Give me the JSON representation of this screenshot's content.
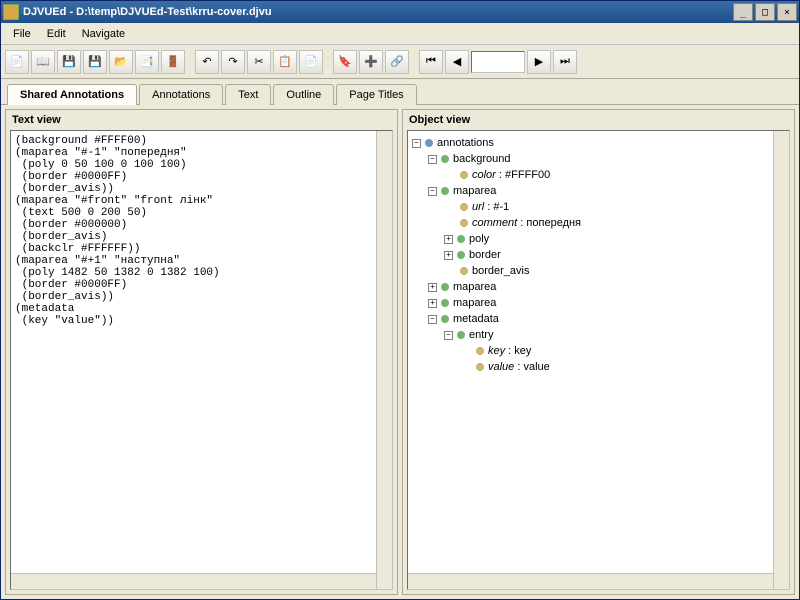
{
  "window": {
    "title": "DJVUEd - D:\\temp\\DJVUEd-Test\\krru-cover.djvu"
  },
  "menus": {
    "file": "File",
    "edit": "Edit",
    "navigate": "Navigate"
  },
  "tabs": {
    "shared": "Shared Annotations",
    "annotations": "Annotations",
    "text": "Text",
    "outline": "Outline",
    "page_titles": "Page Titles"
  },
  "panes": {
    "text_view": "Text view",
    "object_view": "Object view"
  },
  "text_content": "(background #FFFF00)\n(maparea \"#-1\" \"попередня\"\n (poly 0 50 100 0 100 100)\n (border #0000FF)\n (border_avis))\n(maparea \"#front\" \"front лінк\"\n (text 500 0 200 50)\n (border #000000)\n (border_avis)\n (backclr #FFFFFF))\n(maparea \"#+1\" \"наступна\"\n (poly 1482 50 1382 0 1382 100)\n (border #0000FF)\n (border_avis))\n(metadata\n (key \"value\"))",
  "tree": {
    "annotations": "annotations",
    "background": "background",
    "color_k": "color",
    "color_v": "#FFFF00",
    "maparea": "maparea",
    "url_k": "url",
    "url_v": "#-1",
    "comment_k": "comment",
    "comment_v": "попередня",
    "poly": "poly",
    "border": "border",
    "border_avis": "border_avis",
    "metadata": "metadata",
    "entry": "entry",
    "key_k": "key",
    "key_v": "key",
    "value_k": "value",
    "value_v": "value"
  },
  "colors": {
    "node_blue": "#6d94c8",
    "node_green": "#6fb36f",
    "leaf": "#c9b46a"
  }
}
